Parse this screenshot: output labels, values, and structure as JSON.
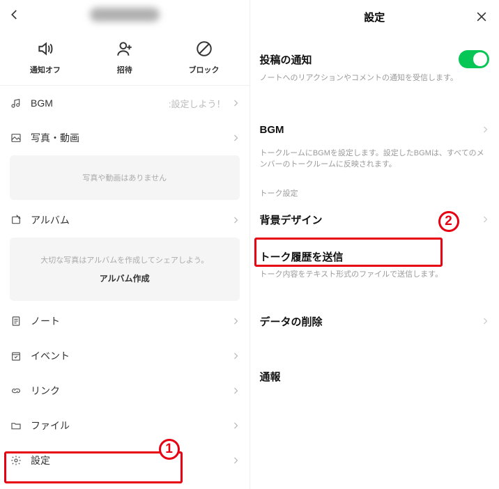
{
  "left": {
    "actions": {
      "mute": "通知オフ",
      "invite": "招待",
      "block": "ブロック"
    },
    "bgm": {
      "label": "BGM",
      "sub": ":設定しよう！"
    },
    "photos": {
      "label": "写真・動画"
    },
    "photos_empty": "写真や動画はありません",
    "album": {
      "label": "アルバム"
    },
    "album_hint": "大切な写真はアルバムを作成してシェアしよう。",
    "album_create": "アルバム作成",
    "note": "ノート",
    "event": "イベント",
    "link": "リンク",
    "file": "ファイル",
    "settings": "設定"
  },
  "right": {
    "header": "設定",
    "post_notif": {
      "title": "投稿の通知",
      "desc": "ノートへのリアクションやコメントの通知を受信します。"
    },
    "bgm": {
      "title": "BGM",
      "desc": "トークルームにBGMを設定します。設定したBGMは、すべてのメンバーのトークルームに反映されます。"
    },
    "talk_section": "トーク設定",
    "bg_design": "背景デザイン",
    "send_history": {
      "title": "トーク履歴を送信",
      "desc": "トーク内容をテキスト形式のファイルで送信します。"
    },
    "delete_data": "データの削除",
    "report": "通報"
  },
  "callouts": {
    "one": "1",
    "two": "2"
  }
}
